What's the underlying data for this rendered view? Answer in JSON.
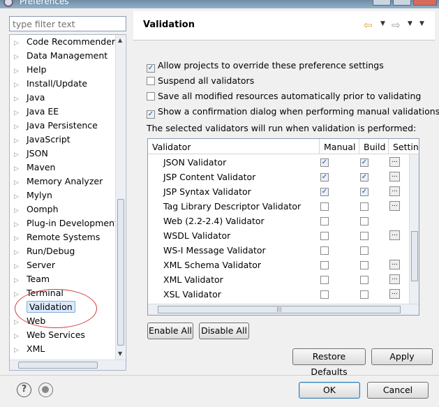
{
  "window": {
    "title": "Preferences"
  },
  "filter": {
    "placeholder": "type filter text"
  },
  "tree": {
    "items": [
      {
        "label": "Code Recommenders",
        "expandable": true
      },
      {
        "label": "Data Management",
        "expandable": true
      },
      {
        "label": "Help",
        "expandable": true
      },
      {
        "label": "Install/Update",
        "expandable": true
      },
      {
        "label": "Java",
        "expandable": true
      },
      {
        "label": "Java EE",
        "expandable": true
      },
      {
        "label": "Java Persistence",
        "expandable": true
      },
      {
        "label": "JavaScript",
        "expandable": true
      },
      {
        "label": "JSON",
        "expandable": true
      },
      {
        "label": "Maven",
        "expandable": true
      },
      {
        "label": "Memory Analyzer",
        "expandable": true
      },
      {
        "label": "Mylyn",
        "expandable": true
      },
      {
        "label": "Oomph",
        "expandable": true
      },
      {
        "label": "Plug-in Development",
        "expandable": true
      },
      {
        "label": "Remote Systems",
        "expandable": true
      },
      {
        "label": "Run/Debug",
        "expandable": true
      },
      {
        "label": "Server",
        "expandable": true
      },
      {
        "label": "Team",
        "expandable": true
      },
      {
        "label": "Terminal",
        "expandable": true
      },
      {
        "label": "Validation",
        "expandable": false,
        "selected": true
      },
      {
        "label": "Web",
        "expandable": true
      },
      {
        "label": "Web Services",
        "expandable": true
      },
      {
        "label": "XML",
        "expandable": true
      }
    ]
  },
  "page": {
    "title": "Validation",
    "options": [
      {
        "label": "Allow projects to override these preference settings",
        "checked": true
      },
      {
        "label": "Suspend all validators",
        "checked": false
      },
      {
        "label": "Save all modified resources automatically prior to validating",
        "checked": false
      },
      {
        "label": "Show a confirmation dialog when performing manual validations",
        "checked": true
      }
    ],
    "info": "The selected validators will run when validation is performed:",
    "table": {
      "headers": [
        "Validator",
        "Manual",
        "Build",
        "Setting"
      ],
      "rows": [
        {
          "name": "JSON Validator",
          "manual": true,
          "build": true,
          "settings": true
        },
        {
          "name": "JSP Content Validator",
          "manual": true,
          "build": true,
          "settings": true
        },
        {
          "name": "JSP Syntax Validator",
          "manual": true,
          "build": true,
          "settings": true
        },
        {
          "name": "Tag Library Descriptor Validator",
          "manual": false,
          "build": false,
          "settings": true
        },
        {
          "name": "Web (2.2-2.4) Validator",
          "manual": false,
          "build": false,
          "settings": false
        },
        {
          "name": "WSDL Validator",
          "manual": false,
          "build": false,
          "settings": true
        },
        {
          "name": "WS-I Message Validator",
          "manual": false,
          "build": false,
          "settings": false
        },
        {
          "name": "XML Schema Validator",
          "manual": false,
          "build": false,
          "settings": true
        },
        {
          "name": "XML Validator",
          "manual": false,
          "build": false,
          "settings": true
        },
        {
          "name": "XSL Validator",
          "manual": false,
          "build": false,
          "settings": true
        }
      ]
    },
    "enable_all": "Enable All",
    "disable_all": "Disable All",
    "restore_defaults": "Restore Defaults",
    "apply": "Apply"
  },
  "footer": {
    "ok": "OK",
    "cancel": "Cancel"
  },
  "colors": {
    "circle": "#d23b3b",
    "accent_nav": "#e0a020",
    "selection": "#dbe9fa"
  },
  "icons": {
    "help": "help-icon",
    "record": "record-icon",
    "back": "back-arrow-icon",
    "forward": "forward-arrow-icon"
  }
}
